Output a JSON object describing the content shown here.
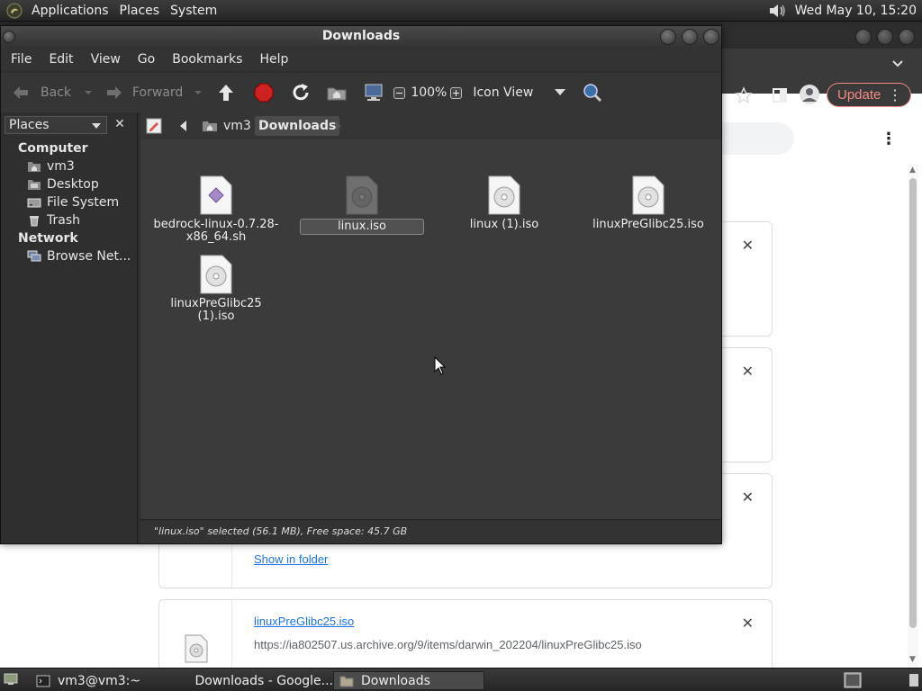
{
  "top_panel": {
    "menus": [
      "Applications",
      "Places",
      "System"
    ],
    "clock": "Wed May 10, 15:20"
  },
  "chrome": {
    "update_label": "Update",
    "update_more": "⋮",
    "page_menu": "⋮",
    "downloads": [
      {
        "close": "✕"
      },
      {
        "close": "✕"
      },
      {
        "close": "✕",
        "link": "Show in folder"
      },
      {
        "close": "✕",
        "name": "linuxPreGlibc25.iso",
        "url": "https://ia802507.us.archive.org/9/items/darwin_202204/linuxPreGlibc25.iso"
      }
    ]
  },
  "nautilus": {
    "title": "Downloads",
    "menu": [
      "File",
      "Edit",
      "View",
      "Go",
      "Bookmarks",
      "Help"
    ],
    "toolbar": {
      "back": "Back",
      "forward": "Forward",
      "zoom": "100%",
      "view_mode": "Icon View"
    },
    "sidebar": {
      "selector": "Places",
      "close": "✕",
      "computer_heading": "Computer",
      "computer_items": [
        "vm3",
        "Desktop",
        "File System",
        "Trash"
      ],
      "network_heading": "Network",
      "network_items": [
        "Browse Net..."
      ]
    },
    "pathbar": [
      "vm3",
      "Downloads"
    ],
    "files": [
      {
        "name": "bedrock-linux-0.7.28-x86_64.sh",
        "line1": "bedrock-linux-0.7.28-",
        "line2": "x86_64.sh",
        "type": "script",
        "selected": false
      },
      {
        "name": "linux.iso",
        "type": "iso",
        "selected": true
      },
      {
        "name": "linux (1).iso",
        "type": "iso",
        "selected": false
      },
      {
        "name": "linuxPreGlibc25.iso",
        "type": "iso",
        "selected": false
      },
      {
        "name": "linuxPreGlibc25 (1).iso",
        "type": "iso",
        "selected": false
      }
    ],
    "status": "\"linux.iso\" selected (56.1 MB), Free space: 45.7 GB"
  },
  "bottom_panel": {
    "tasks": [
      "vm3@vm3:~",
      "Downloads - Google...",
      "Downloads"
    ]
  }
}
